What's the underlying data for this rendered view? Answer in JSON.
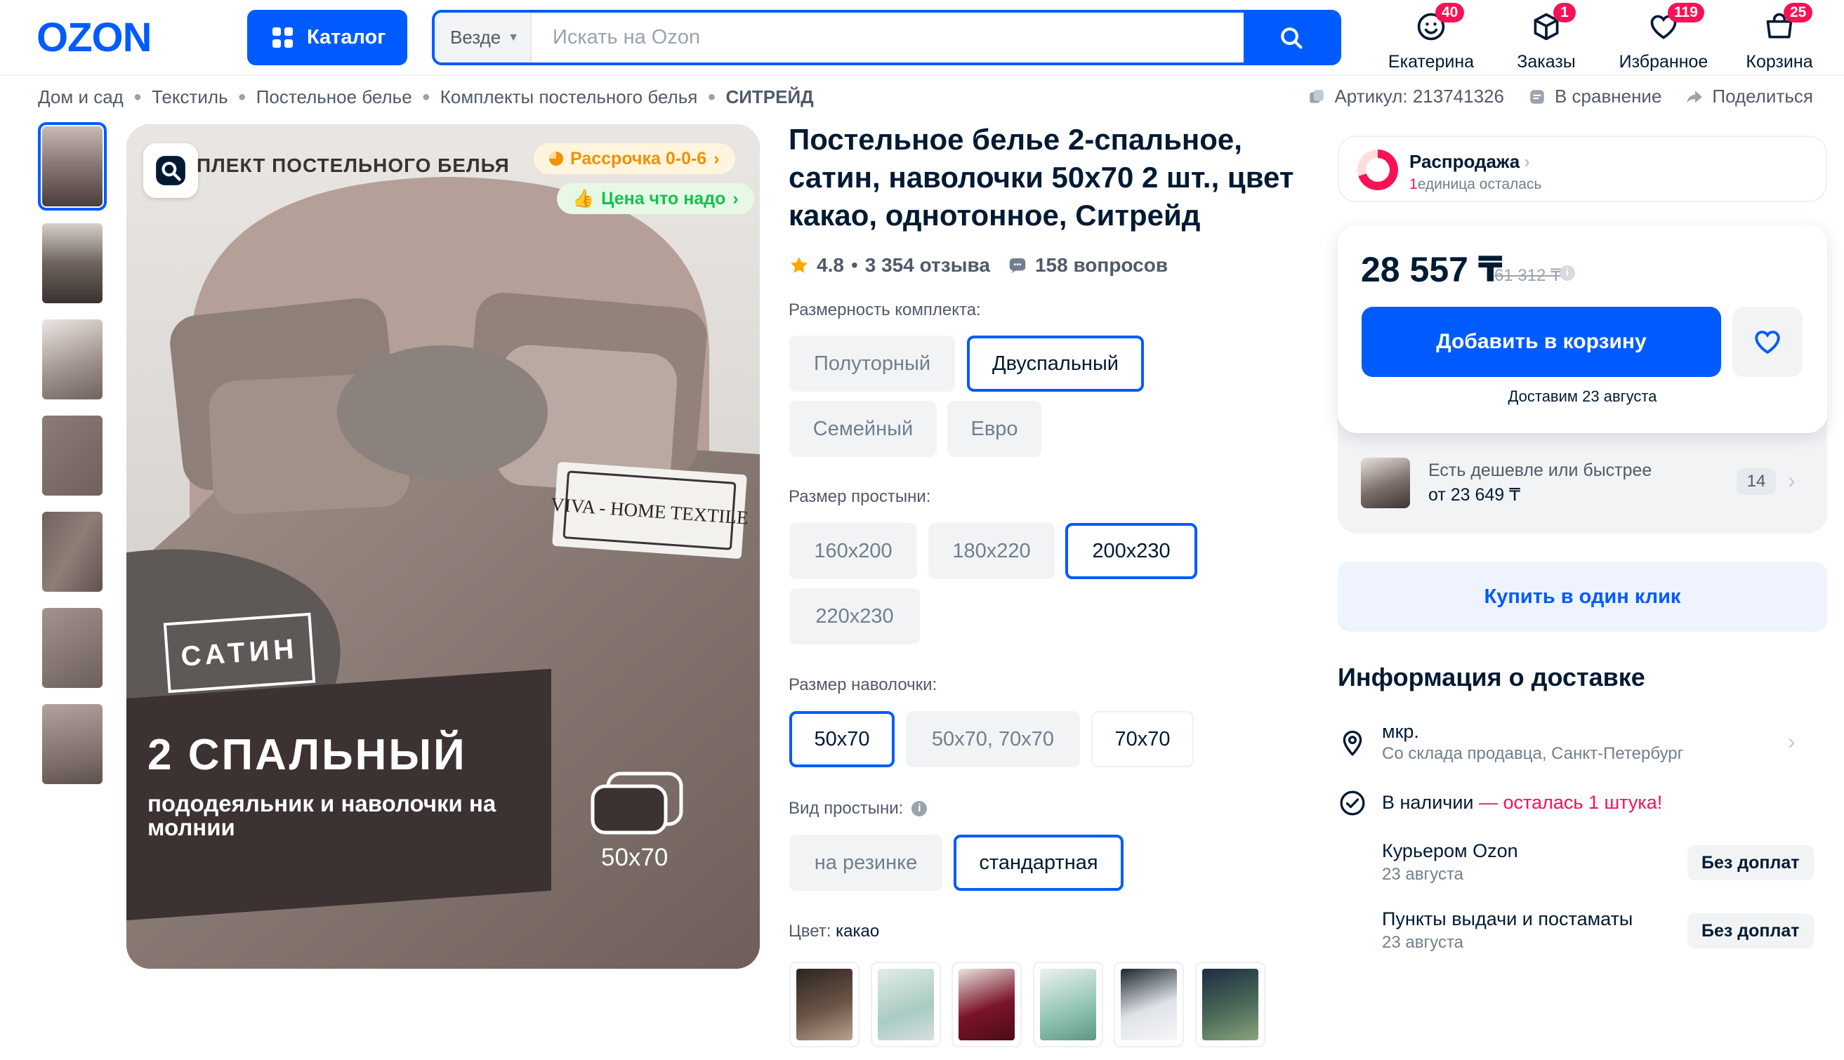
{
  "header": {
    "logo": "OZON",
    "catalog_label": "Каталог",
    "search": {
      "scope": "Везде",
      "placeholder": "Искать на Ozon"
    },
    "items": [
      {
        "label": "Екатерина",
        "badge": "40",
        "icon": "profile-icon"
      },
      {
        "label": "Заказы",
        "badge": "1",
        "icon": "box-icon"
      },
      {
        "label": "Избранное",
        "badge": "119",
        "icon": "heart-icon"
      },
      {
        "label": "Корзина",
        "badge": "25",
        "icon": "cart-icon"
      }
    ]
  },
  "breadcrumbs": [
    "Дом и сад",
    "Текстиль",
    "Постельное белье",
    "Комплекты постельного белья",
    "СИТРЕЙД"
  ],
  "meta": {
    "article": "Артикул: 213741326",
    "compare": "В сравнение",
    "share": "Поделиться"
  },
  "gallery": {
    "image_title": "ПЛЕКТ ПОСТЕЛЬНОГО БЕЛЬЯ",
    "installment": "Рассрочка 0-0-6",
    "good_price": "Цена что надо",
    "brand_tag": "VIVA - HOME TEXTILE",
    "satin": "САТИН",
    "big_title": "2 СПАЛЬНЫЙ",
    "subtitle": "пододеяльник и наволочки на молнии",
    "pillow_size": "50x70"
  },
  "product": {
    "title": "Постельное белье 2-спальное, сатин, наволочки 50х70 2 шт., цвет какао, однотонное, Ситрейд",
    "rating": "4.8",
    "reviews": "3 354 отзыва",
    "questions": "158 вопросов"
  },
  "options": {
    "set_size": {
      "label": "Размерность комплекта:",
      "values": [
        "Полуторный",
        "Двуспальный",
        "Семейный",
        "Евро"
      ],
      "selected": "Двуспальный"
    },
    "sheet_size": {
      "label": "Размер простыни:",
      "values": [
        "160x200",
        "180x220",
        "200x230",
        "220x230"
      ],
      "selected": "200x230"
    },
    "pillow_size": {
      "label": "Размер наволочки:",
      "values": [
        "50x70",
        "50x70, 70x70",
        "70x70"
      ],
      "selected": "50x70"
    },
    "sheet_type": {
      "label": "Вид простыни:",
      "values": [
        "на резинке",
        "стандартная"
      ],
      "selected": "стандартная"
    },
    "color": {
      "label": "Цвет:",
      "value": "какао"
    }
  },
  "sale": {
    "title": "Распродажа",
    "count": "1",
    "remaining": "единица осталась"
  },
  "buy": {
    "price": "28 557 ₸",
    "old_price": "61 312 ₸",
    "add_to_cart": "Добавить в корзину",
    "delivery": "Доставим 23 августа",
    "cheaper_title": "Есть дешевле или быстрее",
    "cheaper_price": "от 23 649 ₸",
    "cheaper_count": "14",
    "one_click": "Купить в один клик"
  },
  "delivery": {
    "title": "Информация о доставке",
    "location": "мкр.",
    "warehouse": "Со склада продавца, Санкт-Петербург",
    "stock": "В наличии",
    "stock_warning": "— осталась 1 штука!",
    "courier": "Курьером Ozon",
    "courier_date": "23 августа",
    "pickup": "Пункты выдачи и постаматы",
    "pickup_date": "23 августа",
    "no_extra": "Без доплат"
  },
  "colors": {
    "brand": "#005bff",
    "sale": "#f91155",
    "swatches": [
      "#5e4b40",
      "#c9d8d2",
      "#7a1428",
      "#a9cdc3",
      "#dfe3e8",
      "#4a6a58"
    ]
  }
}
